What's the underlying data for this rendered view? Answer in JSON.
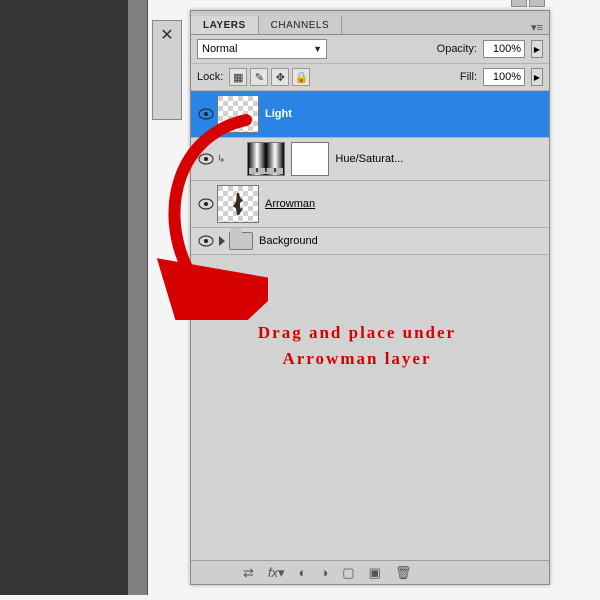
{
  "panel": {
    "tabs": {
      "layers": "LAYERS",
      "channels": "CHANNELS"
    },
    "blend_mode": "Normal",
    "opacity_label": "Opacity:",
    "opacity_value": "100%",
    "lock_label": "Lock:",
    "fill_label": "Fill:",
    "fill_value": "100%",
    "layers": [
      {
        "name": "Light"
      },
      {
        "name": "Hue/Saturat..."
      },
      {
        "name": "Arrowman"
      },
      {
        "name": "Background"
      }
    ]
  },
  "annotation": {
    "line1": "Drag and place under",
    "line2": "Arrowman layer"
  },
  "icons": {
    "tool": "tools-icon",
    "eye": "eye-icon",
    "lock_trans": "transparency-lock",
    "lock_brush": "pixel-lock",
    "lock_move": "position-lock",
    "lock_all": "lock-all"
  }
}
